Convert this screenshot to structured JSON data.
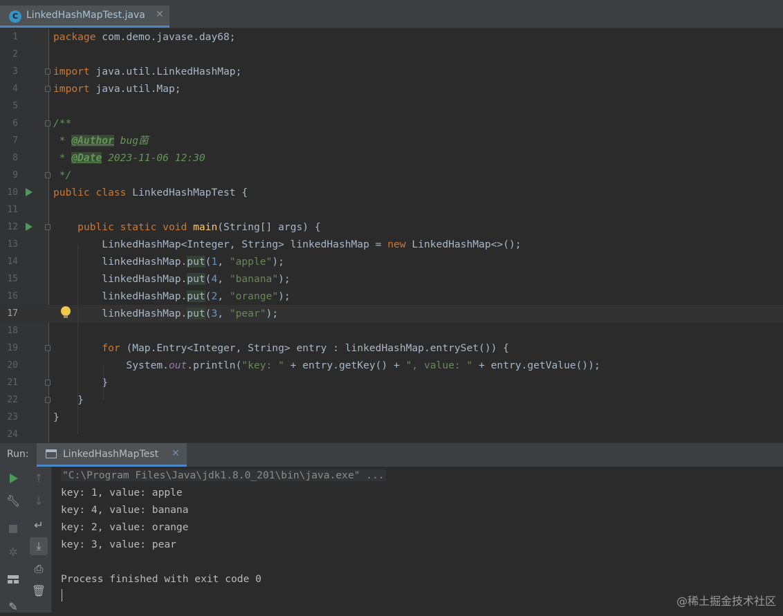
{
  "editor_tab": {
    "label": "LinkedHashMapTest.java",
    "icon": "java-class-icon",
    "close": "✕"
  },
  "code_lines": [
    {
      "n": "1",
      "html": "<span class=\"k\">package</span> com.demo.javase.day68;"
    },
    {
      "n": "2",
      "html": ""
    },
    {
      "n": "3",
      "html": "<span class=\"k\">import</span> java.util.LinkedHashMap;"
    },
    {
      "n": "4",
      "html": "<span class=\"k\">import</span> java.util.Map;"
    },
    {
      "n": "5",
      "html": ""
    },
    {
      "n": "6",
      "html": "<span class=\"c\">/**</span>"
    },
    {
      "n": "7",
      "html": "<span class=\"c\"> * </span><span class=\"cu\">@Author</span><span class=\"c\"> bug菌</span>"
    },
    {
      "n": "8",
      "html": "<span class=\"c\"> * </span><span class=\"cu\">@Date</span><span class=\"c\"> 2023-11-06 12:30</span>"
    },
    {
      "n": "9",
      "html": "<span class=\"c\"> */</span>"
    },
    {
      "n": "10",
      "html": "<span class=\"k\">public class</span> LinkedHashMapTest {"
    },
    {
      "n": "11",
      "html": ""
    },
    {
      "n": "12",
      "html": "    <span class=\"k\">public static void</span> <span class=\"fn\">main</span>(String[] args) {"
    },
    {
      "n": "13",
      "html": "        LinkedHashMap&lt;Integer, String&gt; linkedHashMap = <span class=\"k\">new</span> LinkedHashMap&lt;&gt;();"
    },
    {
      "n": "14",
      "html": "        linkedHashMap.<span class=\"put\">put</span>(<span class=\"num\">1</span>, <span class=\"s\">\"apple\"</span>);"
    },
    {
      "n": "15",
      "html": "        linkedHashMap.<span class=\"put\">put</span>(<span class=\"num\">4</span>, <span class=\"s\">\"banana\"</span>);"
    },
    {
      "n": "16",
      "html": "        linkedHashMap.<span class=\"put\">put</span>(<span class=\"num\">2</span>, <span class=\"s\">\"orange\"</span>);"
    },
    {
      "n": "17",
      "html": "        linkedHashMap.<span class=\"put\">put</span>(<span class=\"num\">3</span>, <span class=\"s\">\"pear\"</span>);"
    },
    {
      "n": "18",
      "html": ""
    },
    {
      "n": "19",
      "html": "        <span class=\"k\">for</span> (Map.Entry&lt;Integer, String&gt; entry : linkedHashMap.entrySet()) {"
    },
    {
      "n": "20",
      "html": "            System.<span class=\"it\">out</span>.println(<span class=\"s\">\"key: \"</span> + entry.getKey() + <span class=\"s\">\", value: \"</span> + entry.getValue());"
    },
    {
      "n": "21",
      "html": "        }"
    },
    {
      "n": "22",
      "html": "    }"
    },
    {
      "n": "23",
      "html": "}"
    },
    {
      "n": "24",
      "html": ""
    }
  ],
  "run_panel": {
    "label": "Run:",
    "tab_label": "LinkedHashMapTest",
    "tab_close": "✕",
    "command": "\"C:\\Program Files\\Java\\jdk1.8.0_201\\bin\\java.exe\" ...",
    "output": [
      "key: 1, value: apple",
      "key: 4, value: banana",
      "key: 2, value: orange",
      "key: 3, value: pear"
    ],
    "exit_message": "Process finished with exit code 0"
  },
  "watermark": "@稀土掘金技术社区",
  "colors": {
    "keyword": "#cc7832",
    "string": "#6a8759",
    "comment": "#629755",
    "method": "#ffc66d",
    "background": "#2b2b2b"
  }
}
